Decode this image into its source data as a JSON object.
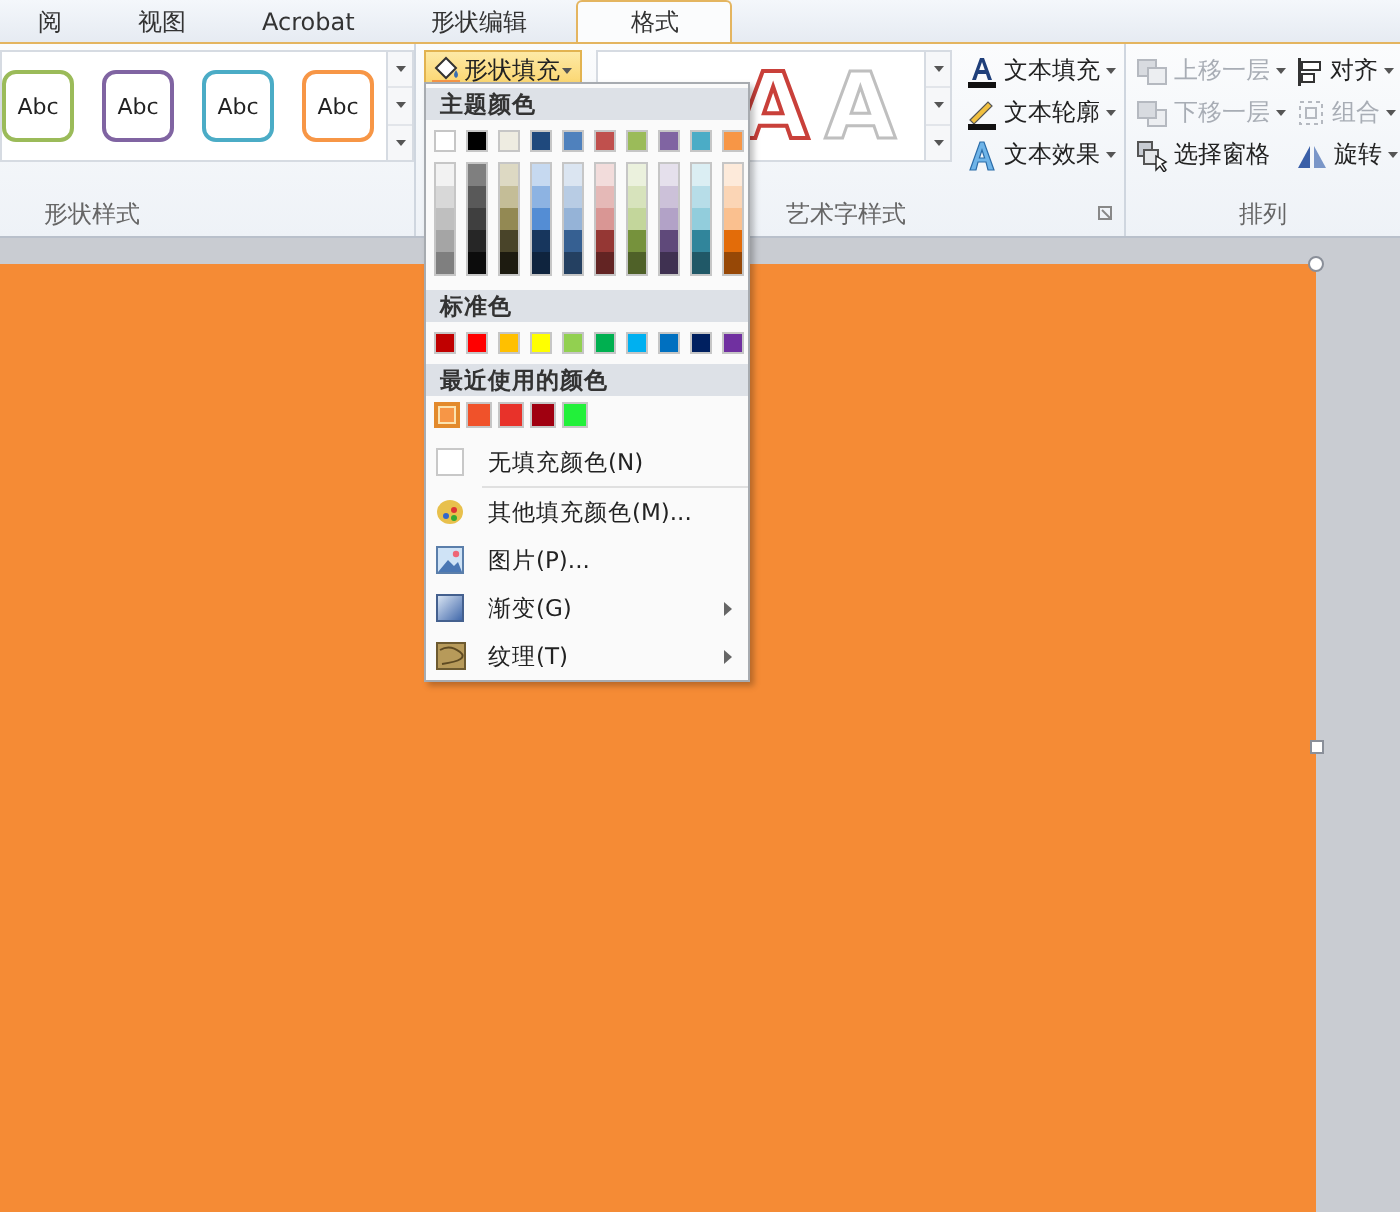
{
  "tabs": [
    {
      "label": "阅",
      "selected": false
    },
    {
      "label": "视图",
      "selected": false
    },
    {
      "label": "Acrobat",
      "selected": false
    },
    {
      "label": "形状编辑",
      "selected": false
    },
    {
      "label": "格式",
      "selected": true
    }
  ],
  "shape_styles": {
    "thumbnails": [
      {
        "label": "Abc",
        "color": "#9bbb59"
      },
      {
        "label": "Abc",
        "color": "#8064a2"
      },
      {
        "label": "Abc",
        "color": "#4bacc6"
      },
      {
        "label": "Abc",
        "color": "#f79646"
      }
    ],
    "group_label": "形状样式"
  },
  "fill_button": {
    "label": "形状填充",
    "expanded": true
  },
  "fill_menu": {
    "theme_heading": "主题颜色",
    "theme_colors": [
      {
        "color": "#ffffff",
        "shades": [
          {
            "color": "#f2f2f2"
          },
          {
            "color": "#d8d8d8"
          },
          {
            "color": "#bfbfbf"
          },
          {
            "color": "#a5a5a5"
          },
          {
            "color": "#7f7f7f"
          }
        ]
      },
      {
        "color": "#000000",
        "shades": [
          {
            "color": "#7f7f7f"
          },
          {
            "color": "#595959"
          },
          {
            "color": "#3f3f3f"
          },
          {
            "color": "#262626"
          },
          {
            "color": "#0c0c0c"
          }
        ]
      },
      {
        "color": "#eeece1",
        "shades": [
          {
            "color": "#ddd9c3"
          },
          {
            "color": "#c4bd97"
          },
          {
            "color": "#938953"
          },
          {
            "color": "#494429"
          },
          {
            "color": "#1d1b10"
          }
        ]
      },
      {
        "color": "#1f497d",
        "shades": [
          {
            "color": "#c6d9f0"
          },
          {
            "color": "#8db3e2"
          },
          {
            "color": "#548dd4"
          },
          {
            "color": "#17365d"
          },
          {
            "color": "#0f243e"
          }
        ]
      },
      {
        "color": "#4f81bd",
        "shades": [
          {
            "color": "#dbe5f1"
          },
          {
            "color": "#b8cce4"
          },
          {
            "color": "#95b3d7"
          },
          {
            "color": "#366092"
          },
          {
            "color": "#244061"
          }
        ]
      },
      {
        "color": "#c0504d",
        "shades": [
          {
            "color": "#f2dcdb"
          },
          {
            "color": "#e5b9b7"
          },
          {
            "color": "#d99694"
          },
          {
            "color": "#953734"
          },
          {
            "color": "#632423"
          }
        ]
      },
      {
        "color": "#9bbb59",
        "shades": [
          {
            "color": "#ebf1dd"
          },
          {
            "color": "#d7e3bc"
          },
          {
            "color": "#c3d69b"
          },
          {
            "color": "#76923c"
          },
          {
            "color": "#4f6128"
          }
        ]
      },
      {
        "color": "#8064a2",
        "shades": [
          {
            "color": "#e5e0ec"
          },
          {
            "color": "#ccc1d9"
          },
          {
            "color": "#b2a2c7"
          },
          {
            "color": "#5f497a"
          },
          {
            "color": "#3f3151"
          }
        ]
      },
      {
        "color": "#4bacc6",
        "shades": [
          {
            "color": "#dbeef3"
          },
          {
            "color": "#b7dde8"
          },
          {
            "color": "#92cddc"
          },
          {
            "color": "#31859b"
          },
          {
            "color": "#205867"
          }
        ]
      },
      {
        "color": "#f79646",
        "shades": [
          {
            "color": "#fdeada"
          },
          {
            "color": "#fbd5b5"
          },
          {
            "color": "#fac08f"
          },
          {
            "color": "#e36c09"
          },
          {
            "color": "#974806"
          }
        ]
      }
    ],
    "standard_heading": "标准色",
    "standard_colors": [
      {
        "color": "#c00000"
      },
      {
        "color": "#ff0000"
      },
      {
        "color": "#ffc000"
      },
      {
        "color": "#ffff00"
      },
      {
        "color": "#92d050"
      },
      {
        "color": "#00b050"
      },
      {
        "color": "#00b0f0"
      },
      {
        "color": "#0070c0"
      },
      {
        "color": "#002060"
      },
      {
        "color": "#7030a0"
      }
    ],
    "recent_heading": "最近使用的颜色",
    "recent_colors": [
      {
        "color": "#f79646",
        "selected": true
      },
      {
        "color": "#f0522a",
        "selected": false
      },
      {
        "color": "#e8322a",
        "selected": false
      },
      {
        "color": "#a00010",
        "selected": false
      },
      {
        "color": "#22f03a",
        "selected": false
      }
    ],
    "items": [
      {
        "label": "无填充颜色(N)",
        "kind": "none",
        "submenu": false
      },
      {
        "label": "其他填充颜色(M)...",
        "kind": "more",
        "submenu": false
      },
      {
        "label": "图片(P)...",
        "kind": "picture",
        "submenu": false
      },
      {
        "label": "渐变(G)",
        "kind": "gradient",
        "submenu": true
      },
      {
        "label": "纹理(T)",
        "kind": "texture",
        "submenu": true
      }
    ]
  },
  "wordart": {
    "samples": [
      {
        "label": "A",
        "kind": "red-outline"
      },
      {
        "label": "A",
        "kind": "gray-outline"
      }
    ],
    "text_buttons": [
      {
        "label": "文本填充",
        "kind": "fill"
      },
      {
        "label": "文本轮廓",
        "kind": "outline"
      },
      {
        "label": "文本效果",
        "kind": "effect"
      }
    ],
    "group_label": "艺术字样式"
  },
  "arrange": {
    "items": [
      {
        "label": "上移一层",
        "kind": "forward",
        "disabled": true
      },
      {
        "label": "对齐",
        "kind": "align",
        "disabled": false
      },
      {
        "label": "下移一层",
        "kind": "backward",
        "disabled": true
      },
      {
        "label": "组合",
        "kind": "group",
        "disabled": true
      },
      {
        "label": "选择窗格",
        "kind": "pane",
        "disabled": false
      },
      {
        "label": "旋转",
        "kind": "rotate",
        "disabled": false
      }
    ],
    "group_label": "排列"
  }
}
